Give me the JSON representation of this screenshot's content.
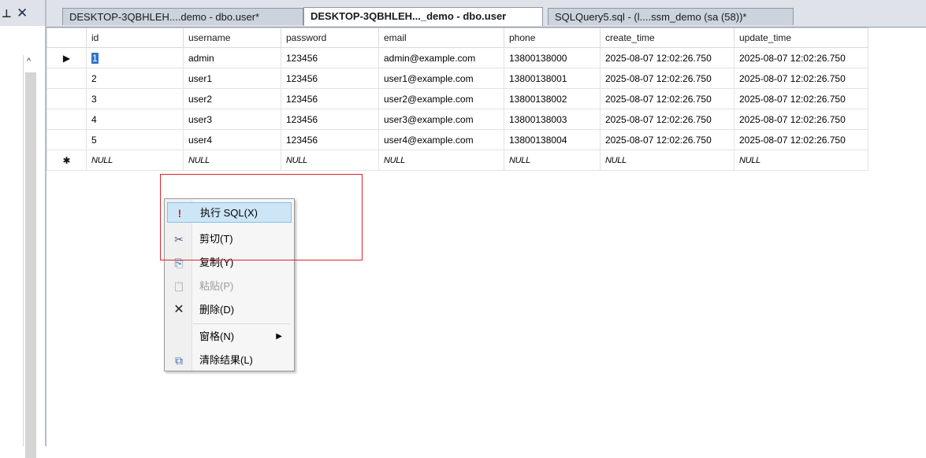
{
  "left_pane": {
    "pin_glyph": "⊥",
    "close_glyph": "✕",
    "scroll_up_glyph": "^"
  },
  "tabs": [
    {
      "label": "DESKTOP-3QBHLEH....demo - dbo.user*",
      "active": false
    },
    {
      "label": "DESKTOP-3QBHLEH..._demo - dbo.user",
      "active": true
    },
    {
      "label": "SQLQuery5.sql - (l....ssm_demo (sa (58))*",
      "active": false
    }
  ],
  "grid": {
    "columns": [
      "id",
      "username",
      "password",
      "email",
      "phone",
      "create_time",
      "update_time"
    ],
    "rows": [
      [
        "1",
        "admin",
        "123456",
        "admin@example.com",
        "13800138000",
        "2025-08-07 12:02:26.750",
        "2025-08-07 12:02:26.750"
      ],
      [
        "2",
        "user1",
        "123456",
        "user1@example.com",
        "13800138001",
        "2025-08-07 12:02:26.750",
        "2025-08-07 12:02:26.750"
      ],
      [
        "3",
        "user2",
        "123456",
        "user2@example.com",
        "13800138002",
        "2025-08-07 12:02:26.750",
        "2025-08-07 12:02:26.750"
      ],
      [
        "4",
        "user3",
        "123456",
        "user3@example.com",
        "13800138003",
        "2025-08-07 12:02:26.750",
        "2025-08-07 12:02:26.750"
      ],
      [
        "5",
        "user4",
        "123456",
        "user4@example.com",
        "13800138004",
        "2025-08-07 12:02:26.750",
        "2025-08-07 12:02:26.750"
      ]
    ],
    "new_row": [
      "NULL",
      "NULL",
      "NULL",
      "NULL",
      "NULL",
      "NULL",
      "NULL"
    ],
    "current_row_marker": "▶",
    "new_row_marker": "✱"
  },
  "context_menu": {
    "items": [
      {
        "label": "执行 SQL(X)",
        "icon": "execute-icon",
        "glyph": "!",
        "hover": true
      },
      {
        "label": "剪切(T)",
        "icon": "scissors-icon",
        "glyph": "✂"
      },
      {
        "label": "复制(Y)",
        "icon": "copy-icon",
        "glyph": "⎘"
      },
      {
        "label": "粘贴(P)",
        "icon": "paste-icon",
        "glyph": "📋",
        "disabled": true
      },
      {
        "label": "删除(D)",
        "icon": "delete-icon",
        "glyph": "✕"
      },
      {
        "label": "窗格(N)",
        "icon": "",
        "submenu": true,
        "arrow": "▶"
      },
      {
        "label": "清除结果(L)",
        "icon": "clear-results-icon",
        "glyph": "⧉"
      }
    ]
  },
  "colors": {
    "highlight_box": "#d9262c",
    "menu_hover": "#cde6f7",
    "selection": "#3276c6"
  }
}
